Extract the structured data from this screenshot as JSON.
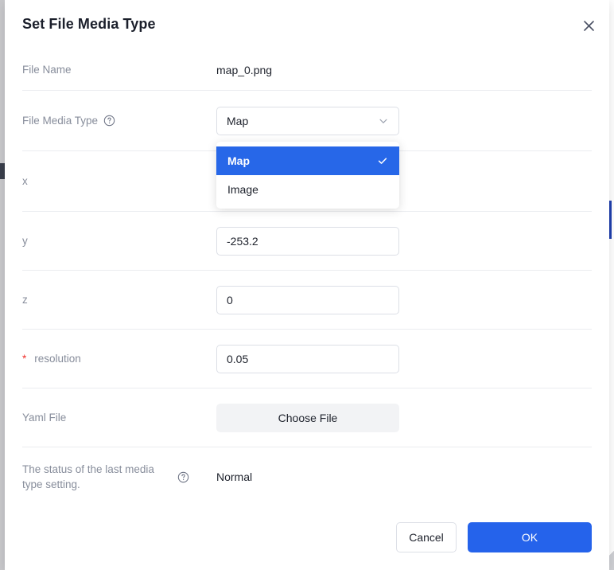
{
  "dialog": {
    "title": "Set File Media Type",
    "close_icon": "close-icon"
  },
  "rows": {
    "file_name": {
      "label": "File Name",
      "value": "map_0.png"
    },
    "file_media_type": {
      "label": "File Media Type",
      "help_icon": "question-circle-icon",
      "selected": "Map",
      "chevron_icon": "chevron-down-icon",
      "options": [
        {
          "label": "Map",
          "selected": true,
          "check_icon": "check-icon"
        },
        {
          "label": "Image",
          "selected": false
        }
      ]
    },
    "x": {
      "label": "x",
      "value": ""
    },
    "y": {
      "label": "y",
      "value": "-253.2"
    },
    "z": {
      "label": "z",
      "value": "0"
    },
    "resolution": {
      "required_marker": "*",
      "label": "resolution",
      "value": "0.05"
    },
    "yaml_file": {
      "label": "Yaml File",
      "button_label": "Choose File"
    },
    "status": {
      "label": "The status of the last media type setting.",
      "help_icon": "question-circle-icon",
      "value": "Normal"
    }
  },
  "footer": {
    "cancel_label": "Cancel",
    "ok_label": "OK"
  },
  "colors": {
    "accent_blue": "#2563eb",
    "option_highlight": "#2767e8",
    "required_red": "#f0332e",
    "label_gray": "#878d9b",
    "divider": "#ebedf0"
  }
}
